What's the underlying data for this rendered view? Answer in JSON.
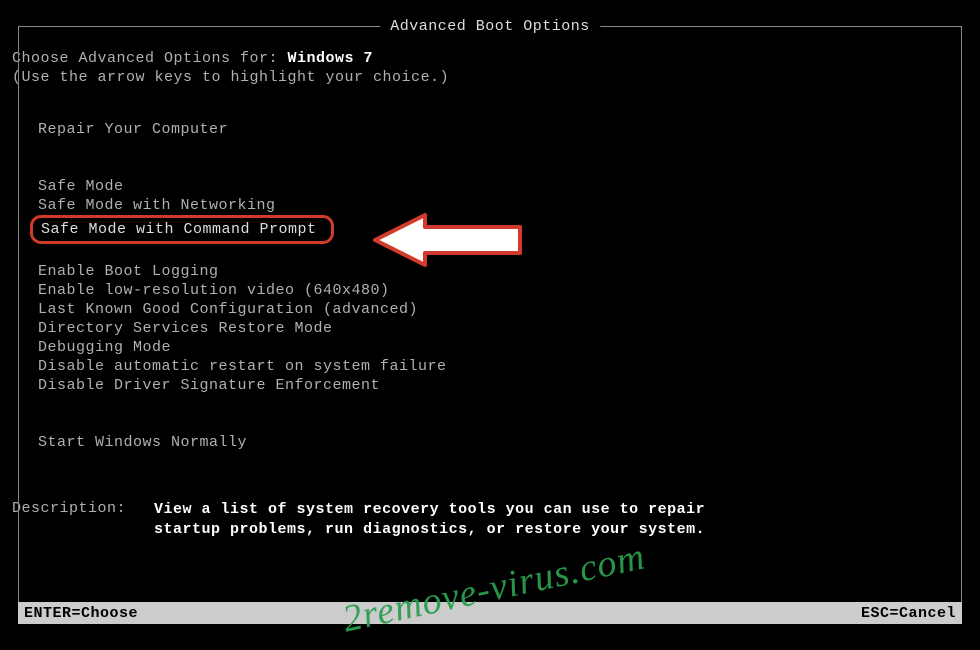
{
  "title": "Advanced Boot Options",
  "choose_prefix": "Choose Advanced Options for: ",
  "os_name": "Windows 7",
  "hint": "(Use the arrow keys to highlight your choice.)",
  "items": {
    "repair": "Repair Your Computer",
    "safe_mode": "Safe Mode",
    "safe_mode_net": "Safe Mode with Networking",
    "safe_mode_cmd": "Safe Mode with Command Prompt",
    "boot_logging": "Enable Boot Logging",
    "lowres": "Enable low-resolution video (640x480)",
    "lkgc": "Last Known Good Configuration (advanced)",
    "dsrm": "Directory Services Restore Mode",
    "debug": "Debugging Mode",
    "no_auto_restart": "Disable automatic restart on system failure",
    "no_sig_enforce": "Disable Driver Signature Enforcement",
    "start_normal": "Start Windows Normally"
  },
  "description_label": "Description:",
  "description_text": "View a list of system recovery tools you can use to repair startup problems, run diagnostics, or restore your system.",
  "status": {
    "enter": "ENTER=Choose",
    "esc": "ESC=Cancel"
  },
  "watermark": "2remove-virus.com"
}
